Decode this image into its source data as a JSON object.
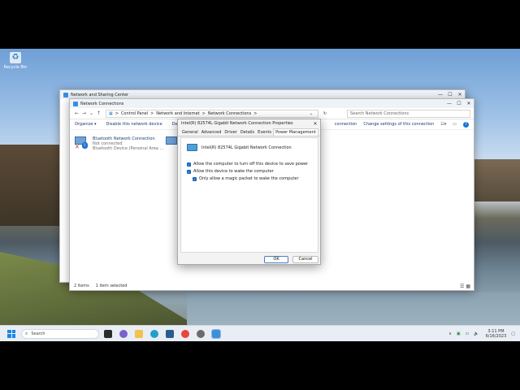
{
  "desktop": {
    "icon_label": "Recycle Bin"
  },
  "nsc_window": {
    "title": "Network and Sharing Center",
    "controls": [
      "—",
      "☐",
      "✕"
    ]
  },
  "nc_window": {
    "title": "Network Connections",
    "controls": [
      "—",
      "☐",
      "✕"
    ],
    "breadcrumb": [
      "Control Panel",
      "Network and Internet",
      "Network Connections"
    ],
    "breadcrumb_sep": ">",
    "search_placeholder": "Search Network Connections",
    "commands": [
      "Organize ▾",
      "Disable this network device",
      "De"
    ],
    "commands_right": [
      "connection",
      "Change settings of this connection"
    ],
    "item": {
      "name": "Bluetooth Network Connection",
      "status": "Not connected",
      "device": "Bluetooth Device (Personal Area ..."
    },
    "status_bar": [
      "2 items",
      "1 item selected"
    ]
  },
  "dialog": {
    "title": "Intel(R) 82574L Gigabit Network Connection Properties",
    "close": "✕",
    "tabs": [
      "General",
      "Advanced",
      "Driver",
      "Details",
      "Events",
      "Power Management"
    ],
    "active_tab": "Power Management",
    "device_name": "Intel(R) 82574L Gigabit Network Connection",
    "options": [
      "Allow the computer to turn off this device to save power",
      "Allow this device to wake the computer",
      "Only allow a magic packet to wake the computer"
    ],
    "ok_label": "OK",
    "cancel_label": "Cancel"
  },
  "taskbar": {
    "search_label": "Search",
    "tray_lang": "ENG",
    "time": "3:11 PM",
    "date": "6/16/2023"
  },
  "colors": {
    "accent": "#1565c0",
    "link": "#1a3c6e"
  }
}
